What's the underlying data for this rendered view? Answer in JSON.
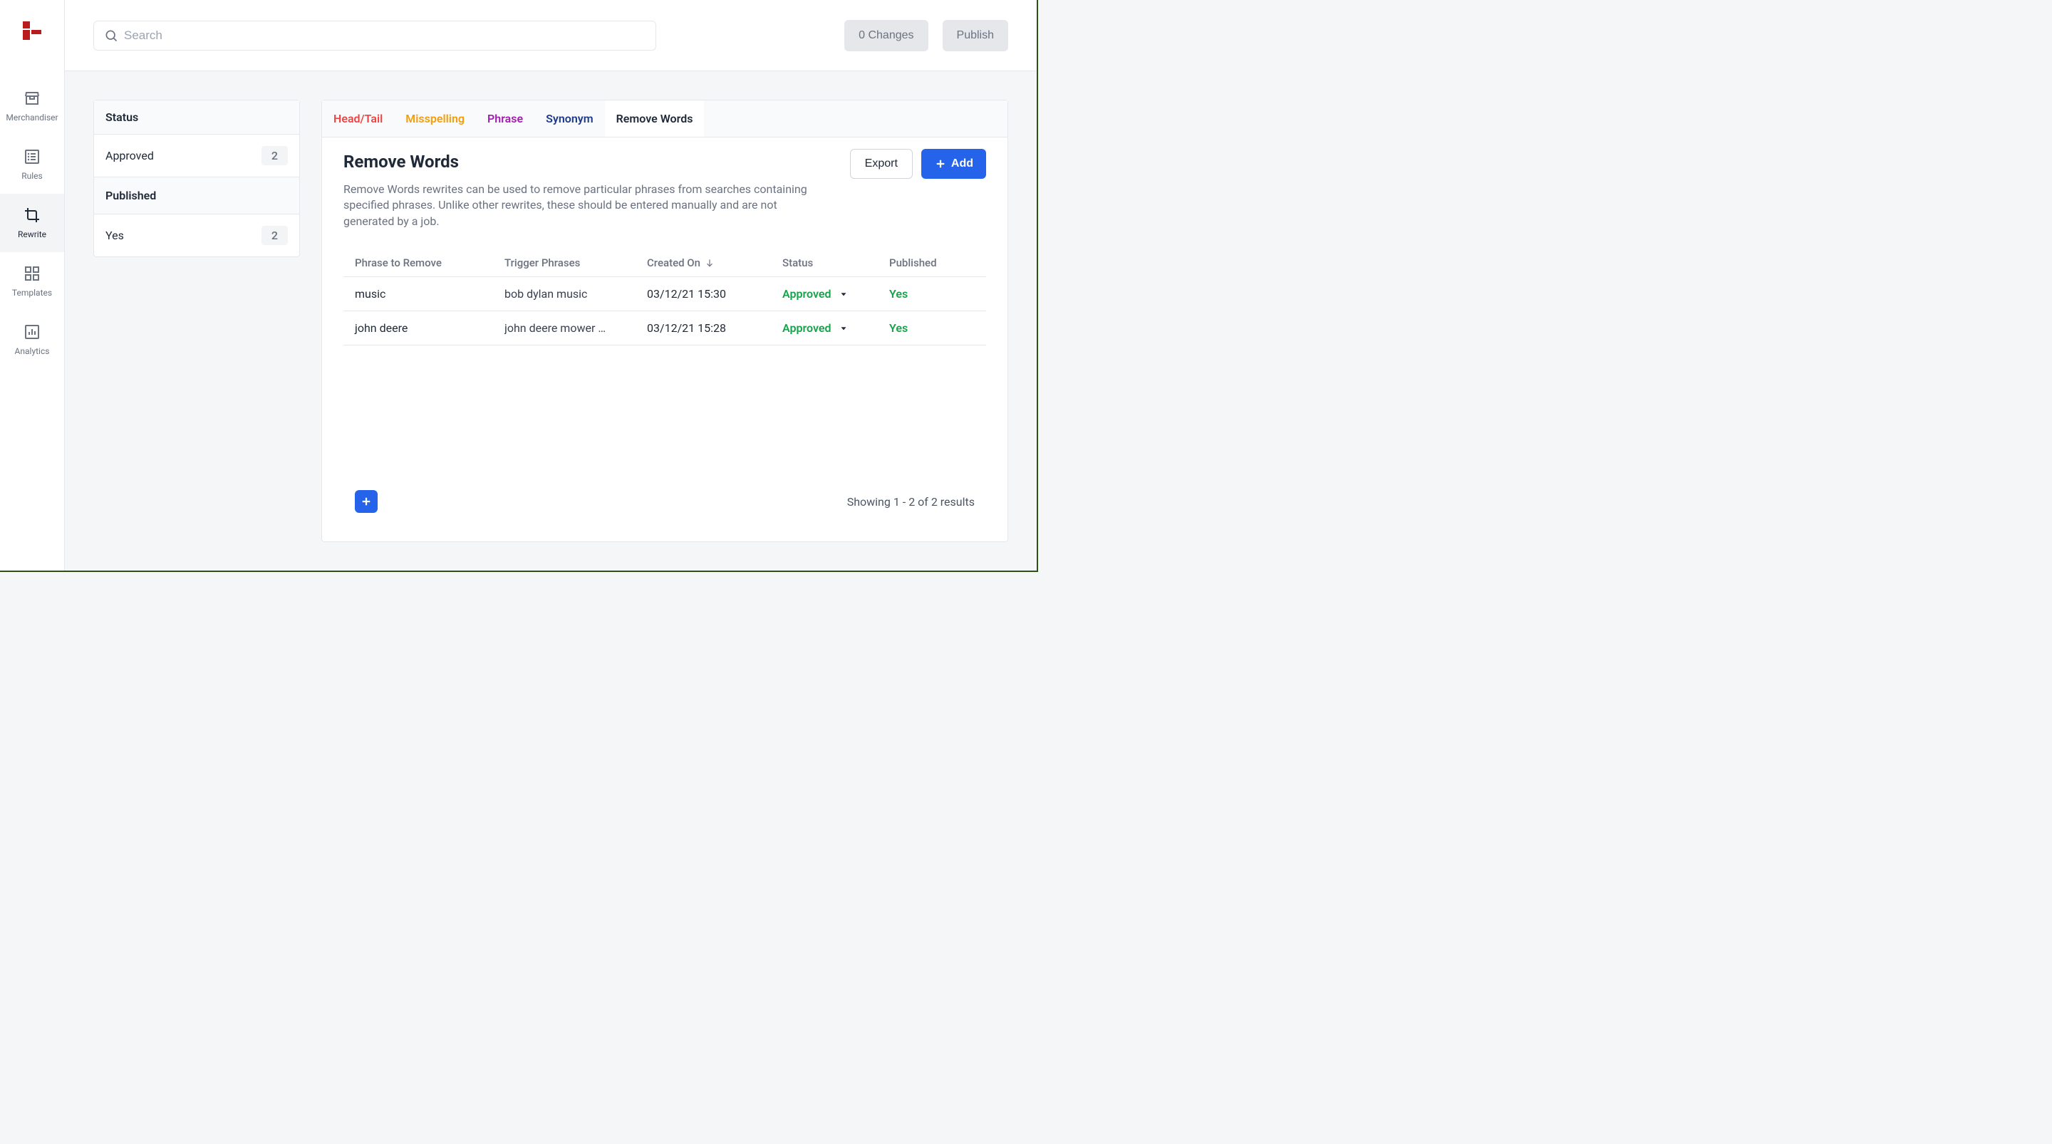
{
  "sidebar": {
    "items": [
      {
        "label": "Merchandiser"
      },
      {
        "label": "Rules"
      },
      {
        "label": "Rewrite"
      },
      {
        "label": "Templates"
      },
      {
        "label": "Analytics"
      }
    ]
  },
  "header": {
    "search_placeholder": "Search",
    "changes_label": "0 Changes",
    "publish_label": "Publish"
  },
  "left_panel": {
    "status_header": "Status",
    "status_label": "Approved",
    "status_count": "2",
    "published_header": "Published",
    "published_label": "Yes",
    "published_count": "2"
  },
  "tabs": [
    {
      "label": "Head/Tail",
      "color": "#ef4444"
    },
    {
      "label": "Misspelling",
      "color": "#f59e0b"
    },
    {
      "label": "Phrase",
      "color": "#a21caf"
    },
    {
      "label": "Synonym",
      "color": "#1e3a8a"
    },
    {
      "label": "Remove Words",
      "color": "#1f2937"
    }
  ],
  "page": {
    "title": "Remove Words",
    "description": "Remove Words rewrites can be used to remove particular phrases from searches containing specified phrases. Unlike other rewrites, these should be entered manually and are not generated by a job.",
    "export_label": "Export",
    "add_label": "Add"
  },
  "table": {
    "columns": {
      "phrase": "Phrase to Remove",
      "trigger": "Trigger Phrases",
      "created": "Created On",
      "status": "Status",
      "published": "Published"
    },
    "rows": [
      {
        "phrase": "music",
        "trigger": "bob dylan music",
        "created": "03/12/21 15:30",
        "status": "Approved",
        "published": "Yes"
      },
      {
        "phrase": "john deere",
        "trigger": "john deere mower …",
        "created": "03/12/21 15:28",
        "status": "Approved",
        "published": "Yes"
      }
    ],
    "results_text": "Showing 1 - 2 of 2 results"
  }
}
